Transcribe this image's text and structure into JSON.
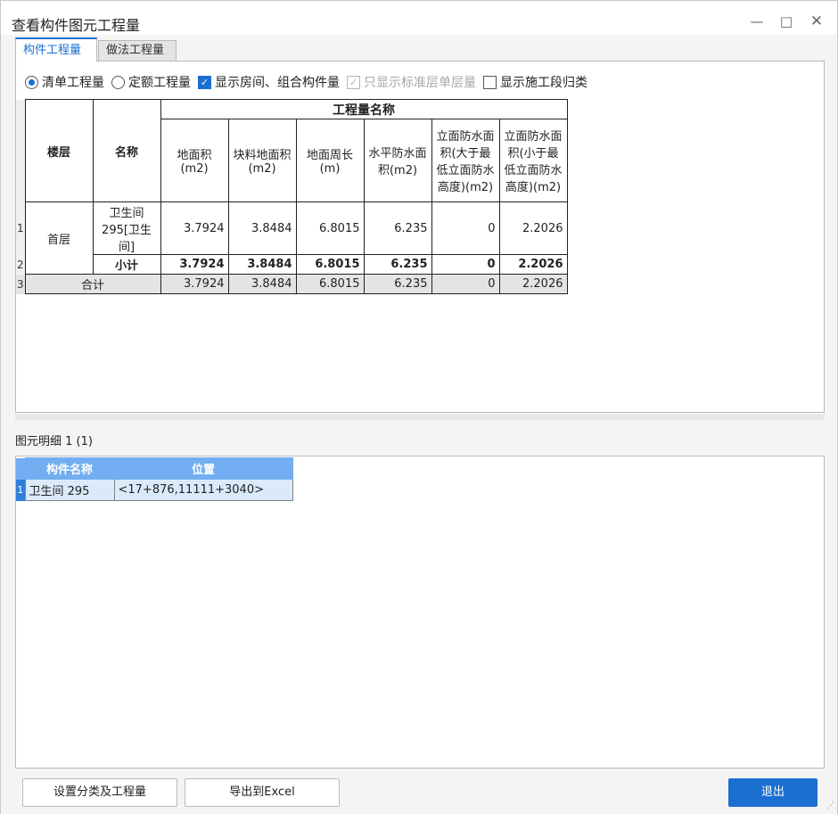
{
  "window": {
    "title": "查看构件图元工程量"
  },
  "controls": {
    "minimize": "—",
    "maximize": "□",
    "close": "✕"
  },
  "tabs": [
    {
      "label": "构件工程量",
      "active": true
    },
    {
      "label": "做法工程量",
      "active": false
    }
  ],
  "options": {
    "radio_list": "清单工程量",
    "radio_quota": "定额工程量",
    "chk_show_room": "显示房间、组合构件量",
    "chk_std_floor": "只显示标准层单层量",
    "chk_stage": "显示施工段归类"
  },
  "table": {
    "col_floor": "楼层",
    "col_name": "名称",
    "group_header": "工程量名称",
    "columns": [
      "地面积(m2)",
      "块料地面积(m2)",
      "地面周长(m)",
      "水平防水面积(m2)",
      "立面防水面积(大于最低立面防水高度)(m2)",
      "立面防水面积(小于最低立面防水高度)(m2)"
    ],
    "row1": {
      "num": "1",
      "floor": "首层",
      "name": "卫生间 295[卫生间]",
      "values": [
        "3.7924",
        "3.8484",
        "6.8015",
        "6.235",
        "0",
        "2.2026"
      ]
    },
    "row2": {
      "num": "2",
      "label": "小计",
      "values": [
        "3.7924",
        "3.8484",
        "6.8015",
        "6.235",
        "0",
        "2.2026"
      ]
    },
    "row3": {
      "num": "3",
      "label": "合计",
      "values": [
        "3.7924",
        "3.8484",
        "6.8015",
        "6.235",
        "0",
        "2.2026"
      ]
    }
  },
  "detail": {
    "label": "图元明细  1 (1)",
    "col_name": "构件名称",
    "col_pos": "位置",
    "rows": [
      {
        "num": "1",
        "name": "卫生间 295",
        "pos": "<17+876,11111+3040>"
      }
    ]
  },
  "buttons": {
    "set_category": "设置分类及工程量",
    "export_excel": "导出到Excel",
    "exit": "退出"
  },
  "colors": {
    "accent": "#1a6fd0",
    "header_blue": "#72aef1"
  }
}
